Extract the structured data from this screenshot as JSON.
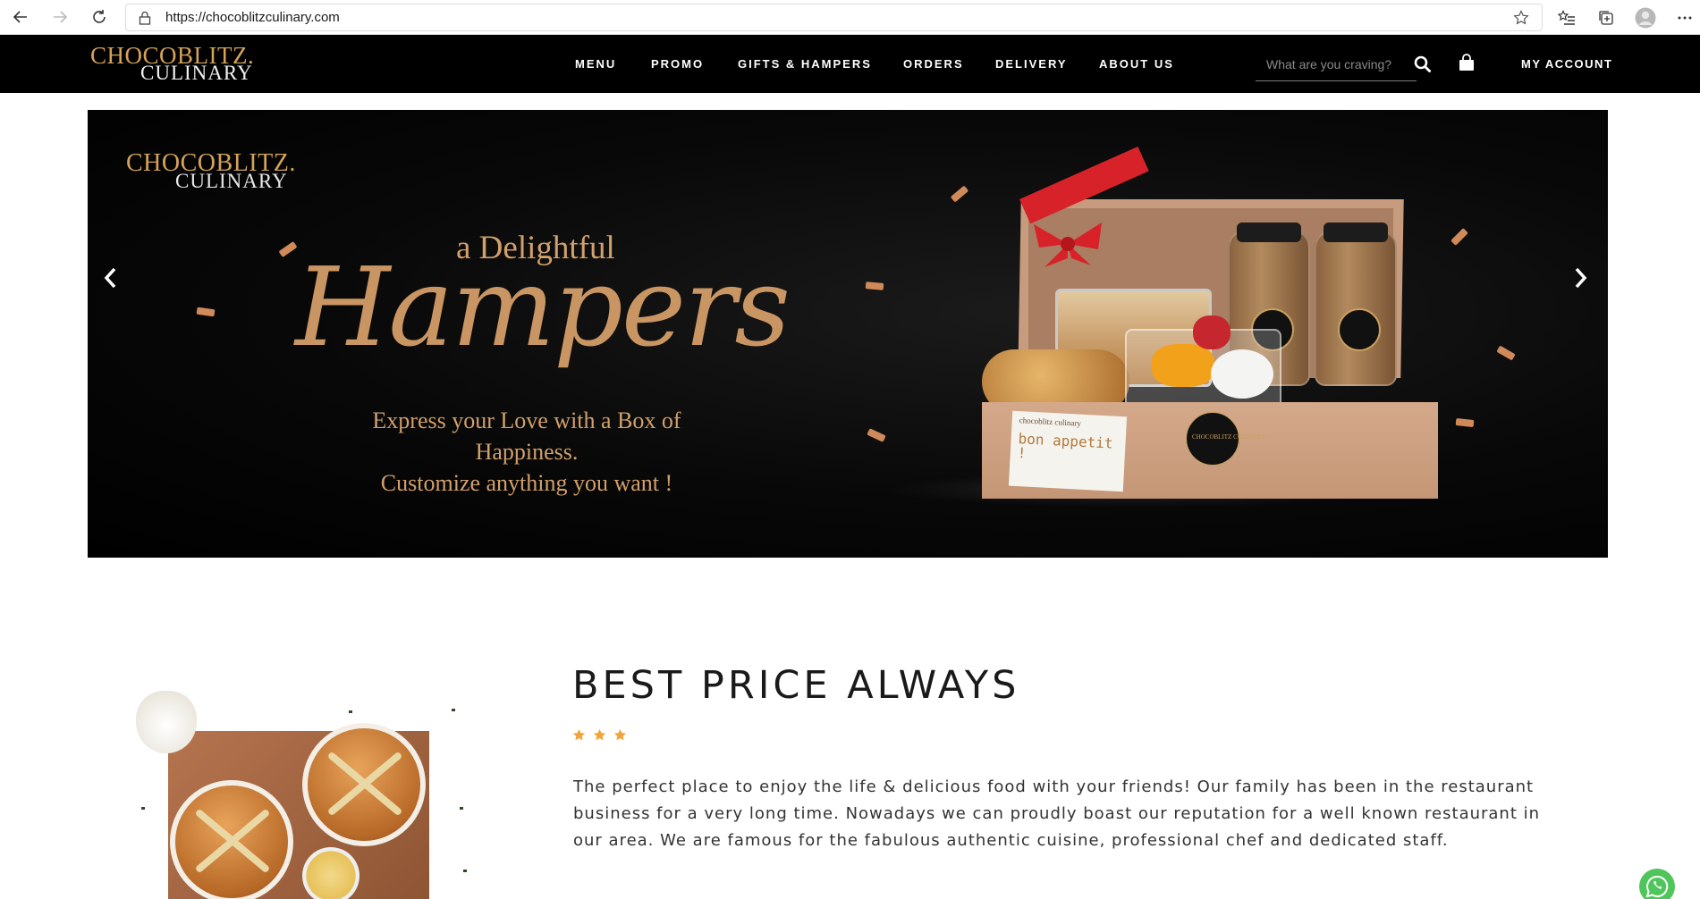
{
  "browser": {
    "url": "https://chocoblitzculinary.com",
    "icons": [
      "back-icon",
      "forward-icon",
      "reload-icon",
      "lock-icon",
      "favorite-star-icon",
      "favorites-list-icon",
      "collections-icon",
      "profile-icon",
      "more-icon"
    ]
  },
  "header": {
    "logo_top": "CHOCOBLITZ.",
    "logo_bottom": "CULINARY",
    "nav": [
      "MENU",
      "PROMO",
      "GIFTS & HAMPERS",
      "ORDERS",
      "DELIVERY",
      "ABOUT US"
    ],
    "search_placeholder": "What are you craving?",
    "account": "MY ACCOUNT"
  },
  "hero": {
    "logo_top": "CHOCOBLITZ.",
    "logo_bottom": "CULINARY",
    "tagline": "a Delightful",
    "headline": "Hampers",
    "subtitle_line1": "Express your Love with a Box of Happiness.",
    "subtitle_line2": "Customize anything you want !",
    "card_brand": "chocoblitz culinary",
    "card_text": "bon appetit !",
    "seal_text": "CHOCOBLITZ CULINARY"
  },
  "intro": {
    "title": "BEST PRICE ALWAYS",
    "rating": 3,
    "body": "The perfect place to enjoy the life & delicious food with your friends! Our family has been in the restaurant business for a very long time. Nowadays we can proudly boast our reputation for a well known restaurant in our area. We are famous for the fabulous authentic cuisine, professional chef and dedicated staff."
  },
  "colors": {
    "gold": "#d4a35a",
    "hamper_gold": "#c99663",
    "star": "#f2a33a",
    "whatsapp": "#4fc55b"
  }
}
